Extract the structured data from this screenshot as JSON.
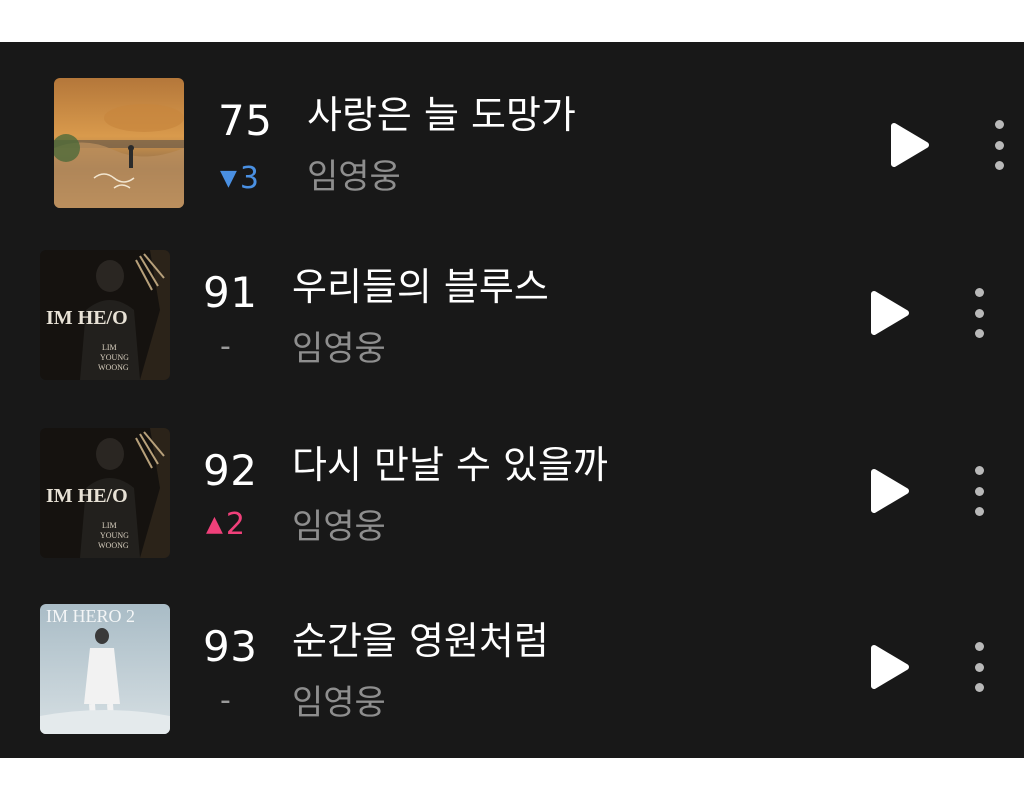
{
  "chart_list": {
    "items": [
      {
        "rank": "75",
        "change": "3",
        "change_direction": "down",
        "change_arrow": "▼",
        "title": "사랑은 늘 도망가",
        "artist": "임영웅",
        "art_icon": "album-art-sunset"
      },
      {
        "rank": "91",
        "change": "-",
        "change_direction": "none",
        "change_arrow": "",
        "title": "우리들의 블루스",
        "artist": "임영웅",
        "art_icon": "album-art-im-hero"
      },
      {
        "rank": "92",
        "change": "2",
        "change_direction": "up",
        "change_arrow": "▲",
        "title": "다시 만날 수 있을까",
        "artist": "임영웅",
        "art_icon": "album-art-im-hero"
      },
      {
        "rank": "93",
        "change": "-",
        "change_direction": "none",
        "change_arrow": "",
        "title": "순간을 영원처럼",
        "artist": "임영웅",
        "art_icon": "album-art-im-hero-2"
      }
    ],
    "album_art_text": {
      "im_hero": "IM HE/O",
      "im_hero_2": "IM HERO 2"
    }
  },
  "colors": {
    "background": "#181818",
    "rank_down": "#4a90e2",
    "rank_up": "#f0407a",
    "artist_text": "#8e8e8e",
    "icon": "#ffffff"
  }
}
